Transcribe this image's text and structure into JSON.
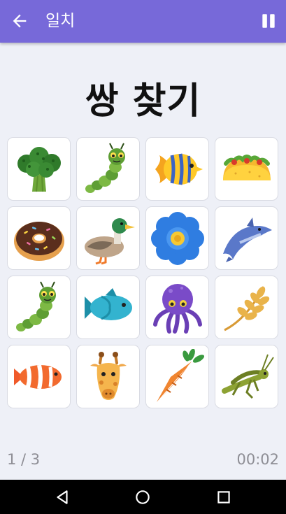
{
  "appbar": {
    "title": "일치",
    "back_icon": "back-arrow-icon",
    "pause_icon": "pause-icon",
    "color": "#7769d9"
  },
  "heading": "쌍 찾기",
  "cards": [
    {
      "icon": "broccoli-icon"
    },
    {
      "icon": "caterpillar-icon"
    },
    {
      "icon": "tropical-fish-icon"
    },
    {
      "icon": "taco-icon"
    },
    {
      "icon": "donut-icon"
    },
    {
      "icon": "duck-icon"
    },
    {
      "icon": "blue-flower-icon"
    },
    {
      "icon": "dolphin-icon"
    },
    {
      "icon": "caterpillar-icon"
    },
    {
      "icon": "fish-icon"
    },
    {
      "icon": "octopus-icon"
    },
    {
      "icon": "wheat-icon"
    },
    {
      "icon": "clownfish-icon"
    },
    {
      "icon": "giraffe-icon"
    },
    {
      "icon": "carrot-icon"
    },
    {
      "icon": "grasshopper-icon"
    }
  ],
  "footer": {
    "progress": "1 / 3",
    "timer": "00:02"
  },
  "navbar": {
    "back": "nav-back-icon",
    "home": "nav-home-icon",
    "recents": "nav-recents-icon"
  }
}
